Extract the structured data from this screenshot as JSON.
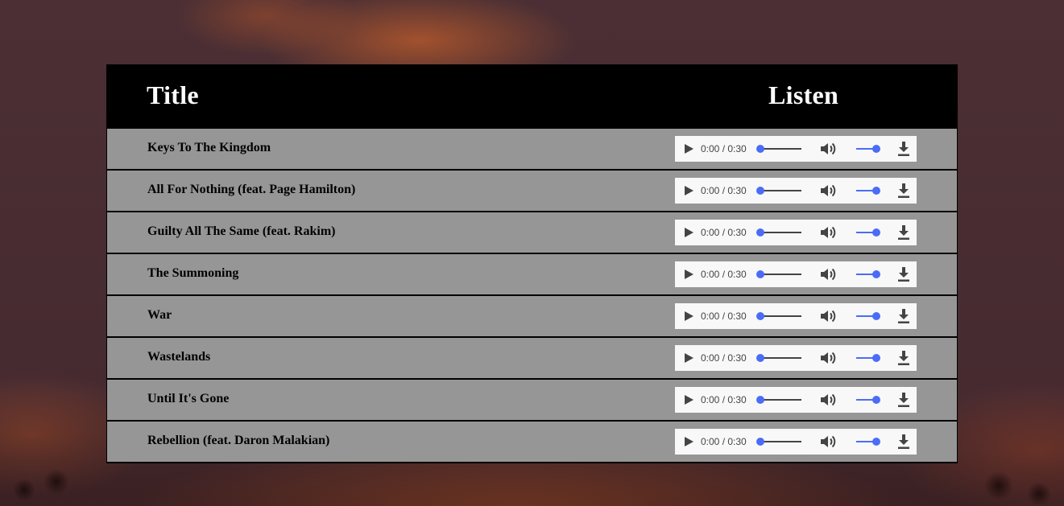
{
  "header": {
    "title_col": "Title",
    "listen_col": "Listen"
  },
  "tracks": [
    {
      "title": "Keys To The Kingdom",
      "time": "0:00 / 0:30"
    },
    {
      "title": "All For Nothing (feat. Page Hamilton)",
      "time": "0:00 / 0:30"
    },
    {
      "title": "Guilty All The Same (feat. Rakim)",
      "time": "0:00 / 0:30"
    },
    {
      "title": "The Summoning",
      "time": "0:00 / 0:30"
    },
    {
      "title": "War",
      "time": "0:00 / 0:30"
    },
    {
      "title": "Wastelands",
      "time": "0:00 / 0:30"
    },
    {
      "title": "Until It's Gone",
      "time": "0:00 / 0:30"
    },
    {
      "title": "Rebellion (feat. Daron Malakian)",
      "time": "0:00 / 0:30"
    }
  ],
  "player": {
    "progress": 0,
    "volume": 1,
    "icons": [
      "play-icon",
      "volume-icon",
      "download-icon"
    ]
  },
  "colors": {
    "panel_header": "#000000",
    "row_background": "#969696",
    "slider_accent": "#4a6cf7"
  }
}
